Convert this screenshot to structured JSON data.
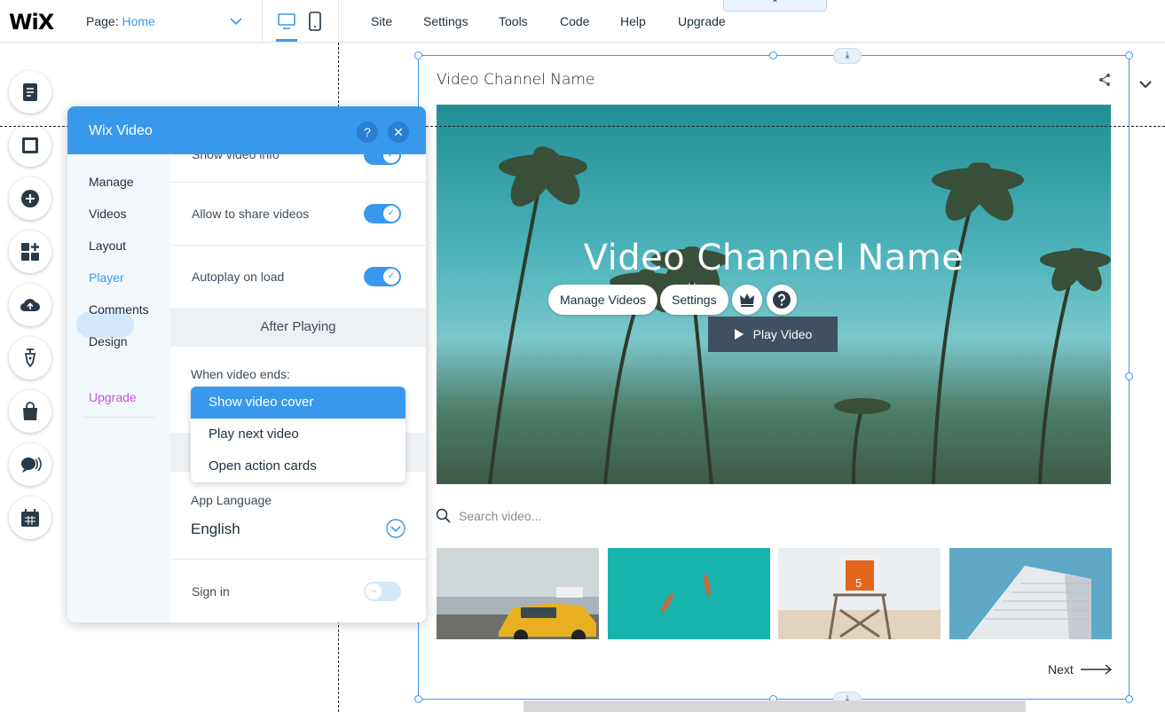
{
  "topbar": {
    "logo": "WiX",
    "page_label": "Page:",
    "page_value": "Home",
    "collapse_glyph": "⌃",
    "menu": [
      "Site",
      "Settings",
      "Tools",
      "Code",
      "Help",
      "Upgrade"
    ]
  },
  "sidebar_tools": [
    "pages-icon",
    "background-icon",
    "add-icon",
    "add-apps-icon",
    "upload-icon",
    "pen-icon",
    "store-icon",
    "chat-icon",
    "bookings-icon"
  ],
  "canvas": {
    "channel_title": "Video Channel Name",
    "hero_title": "Video Channel Name",
    "manage_videos": "Manage Videos",
    "settings": "Settings",
    "play_video": "Play Video",
    "search_placeholder": "Search video...",
    "thumbnails": [
      "taxi",
      "kayaks",
      "lifeguard-tower",
      "building"
    ],
    "lifeguard_number": "5",
    "next": "Next",
    "anchor_glyph": "⤓"
  },
  "panel": {
    "title": "Wix Video",
    "help": "?",
    "close": "✕",
    "nav": [
      "Manage",
      "Videos",
      "Layout",
      "Player",
      "Comments",
      "Design"
    ],
    "upgrade": "Upgrade",
    "partial_row": "Show video info",
    "allow_share": "Allow to share videos",
    "autoplay": "Autoplay on load",
    "after_playing": "After Playing",
    "when_ends": "When video ends:",
    "options": [
      "Show video cover",
      "Play next video",
      "Open action cards"
    ],
    "app_language_label": "App Language",
    "app_language_value": "English",
    "sign_in": "Sign in",
    "check": "✓",
    "dash": "–"
  },
  "colors": {
    "accent": "#3899ec",
    "upgrade": "#c355d6",
    "play_bg": "#3f5062"
  }
}
